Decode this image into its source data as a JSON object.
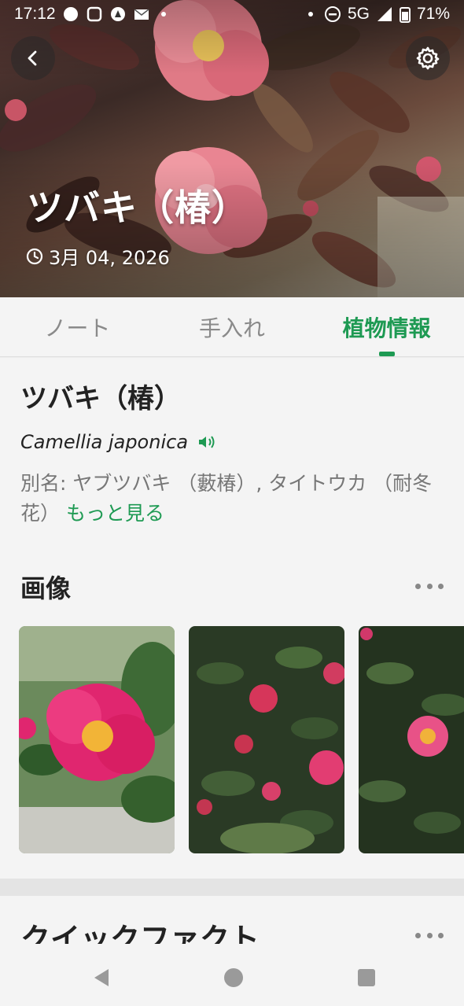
{
  "status_bar": {
    "time": "17:12",
    "network": "5G",
    "battery": "71%"
  },
  "hero": {
    "title": "ツバキ（椿）",
    "date": "3月 04, 2026"
  },
  "tabs": [
    {
      "label": "ノート",
      "active": false
    },
    {
      "label": "手入れ",
      "active": false
    },
    {
      "label": "植物情報",
      "active": true
    }
  ],
  "info": {
    "name": "ツバキ（椿）",
    "scientific_name": "Camellia japonica",
    "aliases_prefix": "別名: ヤブツバキ （藪椿）, タイトウカ （耐冬花）",
    "more_link": "もっと見る"
  },
  "images_section": {
    "title": "画像"
  },
  "quick_facts": {
    "title": "クイックファクト"
  },
  "colors": {
    "accent": "#1e9a53",
    "text": "#222222",
    "muted": "#777777"
  },
  "icons": [
    "back-arrow-icon",
    "gear-icon",
    "clock-icon",
    "speaker-icon",
    "more-dots-icon",
    "nav-back-icon",
    "nav-home-icon",
    "nav-recents-icon"
  ]
}
